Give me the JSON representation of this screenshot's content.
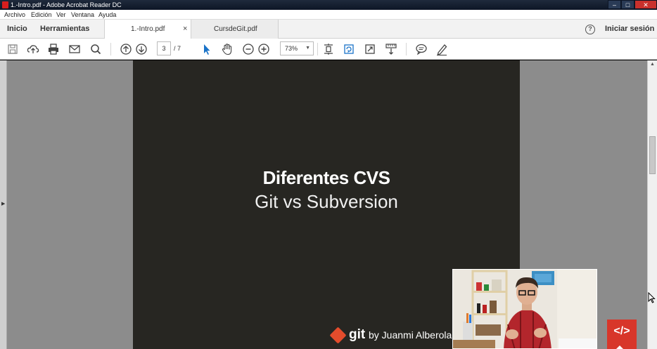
{
  "window": {
    "title": "1.-Intro.pdf - Adobe Acrobat Reader DC",
    "controls": {
      "minimize": "–",
      "maximize": "□",
      "close": "✕"
    }
  },
  "menubar": {
    "items": [
      "Archivo",
      "Edición",
      "Ver",
      "Ventana",
      "Ayuda"
    ]
  },
  "tabbar": {
    "nav": [
      "Inicio",
      "Herramientas"
    ],
    "tabs": [
      {
        "label": "1.-Intro.pdf",
        "close": "×",
        "active": true
      },
      {
        "label": "CursdeGit.pdf",
        "active": false
      }
    ],
    "help": "?",
    "signin": "Iniciar sesión"
  },
  "toolbar": {
    "icons": [
      "save-icon",
      "upload-icon",
      "print-icon",
      "mail-icon",
      "search-icon",
      "page-up-icon",
      "page-down-icon",
      "select-cursor-icon",
      "hand-tool-icon",
      "zoom-out-icon",
      "zoom-in-icon",
      "fit-page-icon",
      "rotate-icon",
      "full-screen-icon",
      "scroll-mode-icon",
      "comment-icon",
      "highlight-pen-icon"
    ],
    "page_current": "3",
    "page_total": "/ 7",
    "zoom": "73%",
    "zoom_arrow": "▼"
  },
  "slide": {
    "title": "Diferentes CVS",
    "subtitle": "Git vs Subversion",
    "logo_word": "git",
    "byline": "by Juanmi Alberola"
  },
  "overlay": {
    "badge_text": "</>",
    "accent": "#d8362a"
  },
  "colors": {
    "slide_bg": "#272622",
    "workspace_bg": "#8c8c8c",
    "accent_blue": "#1a73c8"
  }
}
